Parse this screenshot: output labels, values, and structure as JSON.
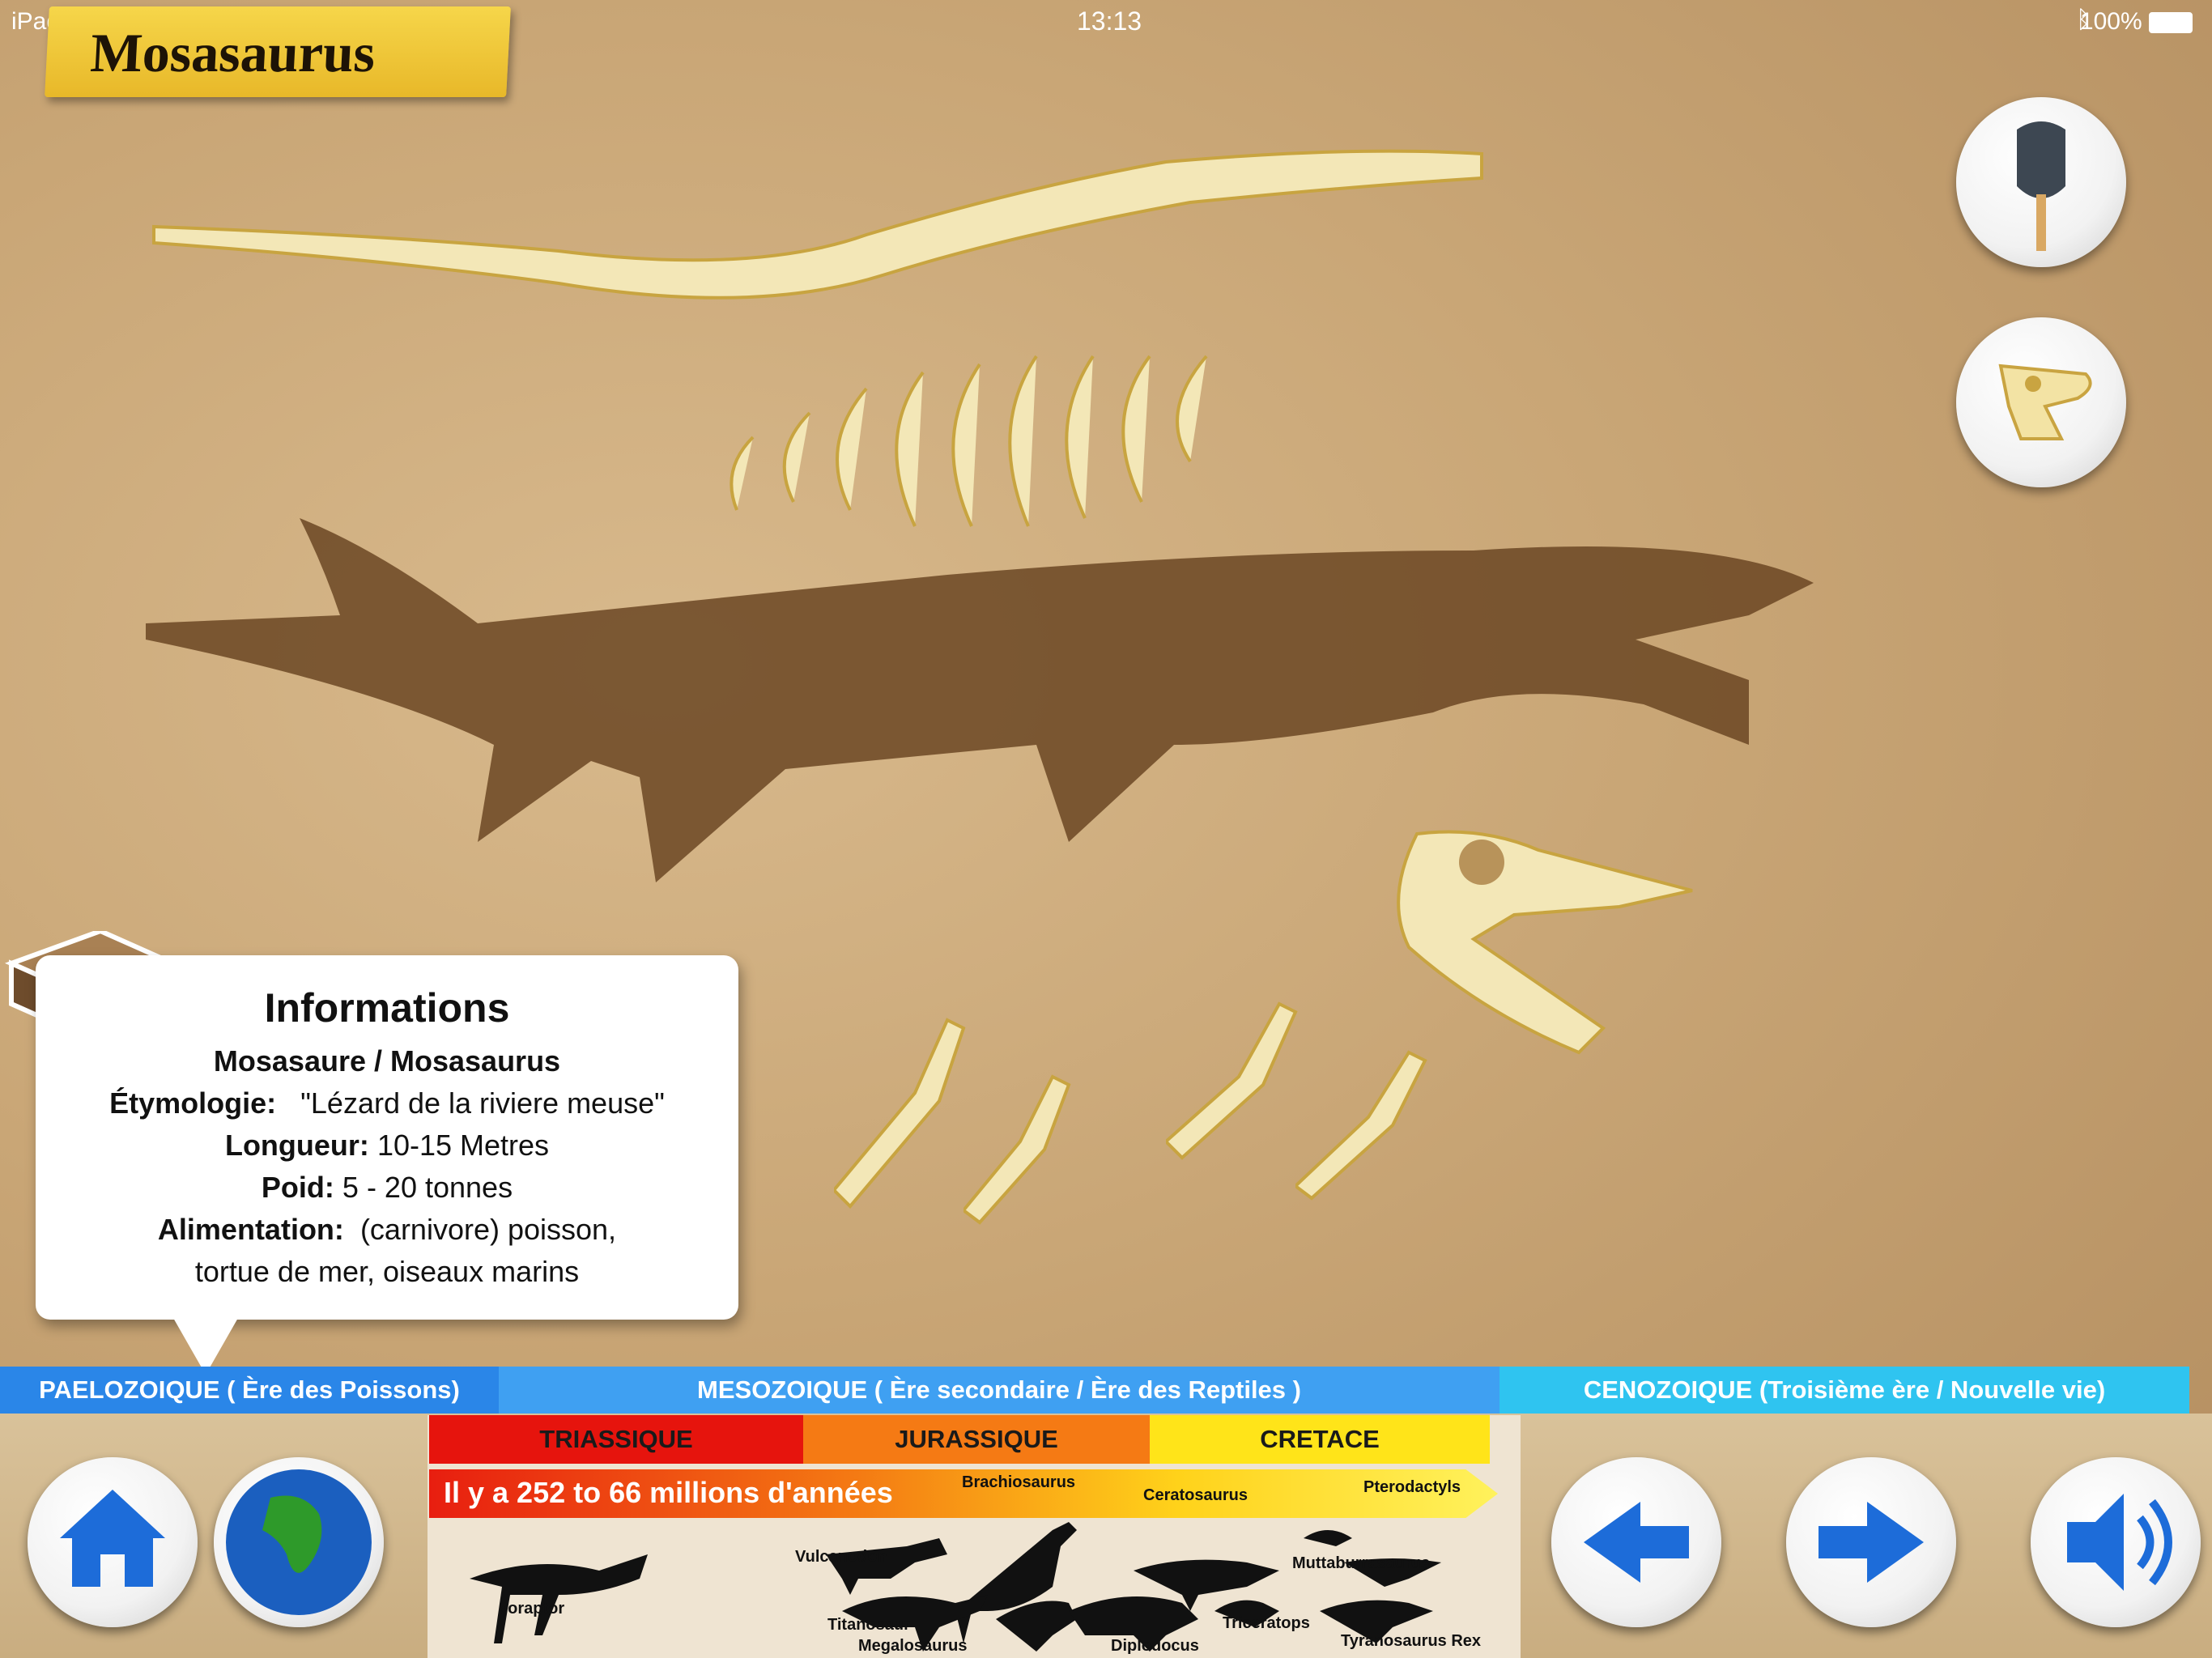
{
  "status_bar": {
    "device": "iPad",
    "time": "13:13",
    "battery": "100%"
  },
  "title": "Mosasaurus",
  "info": {
    "heading": "Informations",
    "name": "Mosasaure / Mosasaurus",
    "etymology_label": "Étymologie:",
    "etymology_value": "\"Lézard de la riviere meuse\"",
    "length_label": "Longueur:",
    "length_value": "10-15 Metres",
    "weight_label": "Poid:",
    "weight_value": "5 - 20 tonnes",
    "diet_label": "Alimentation:",
    "diet_value": "(carnivore) poisson,",
    "diet_value_2": "tortue de mer, oiseaux marins"
  },
  "eras": [
    {
      "label": "PAELOZOIQUE  ( Ère des Poissons)",
      "color": "#2a86e8"
    },
    {
      "label": "MESOZOIQUE    ( Ère secondaire / Ère des Reptiles )",
      "color": "#3fa0f2"
    },
    {
      "label": "CENOZOIQUE  (Troisième ère / Nouvelle vie)",
      "color": "#2fc4f0"
    }
  ],
  "periods": [
    {
      "label": "TRIASSIQUE",
      "color": "#e6140d"
    },
    {
      "label": "JURASSIQUE",
      "color": "#f57a14"
    },
    {
      "label": "CRETACE",
      "color": "#ffe419"
    }
  ],
  "years_text": "Il y a 252 to 66 millions d'années",
  "dinosaurs": [
    "Brachiosaurus",
    "Ceratosaurus",
    "Pterodactyls",
    "Vulcanodon",
    "Muttaburrasaurus",
    "eoraptor",
    "Titanosaur",
    "Megalosaurus",
    "Diplodocus",
    "Triceratops",
    "Tyranosaurus Rex"
  ]
}
